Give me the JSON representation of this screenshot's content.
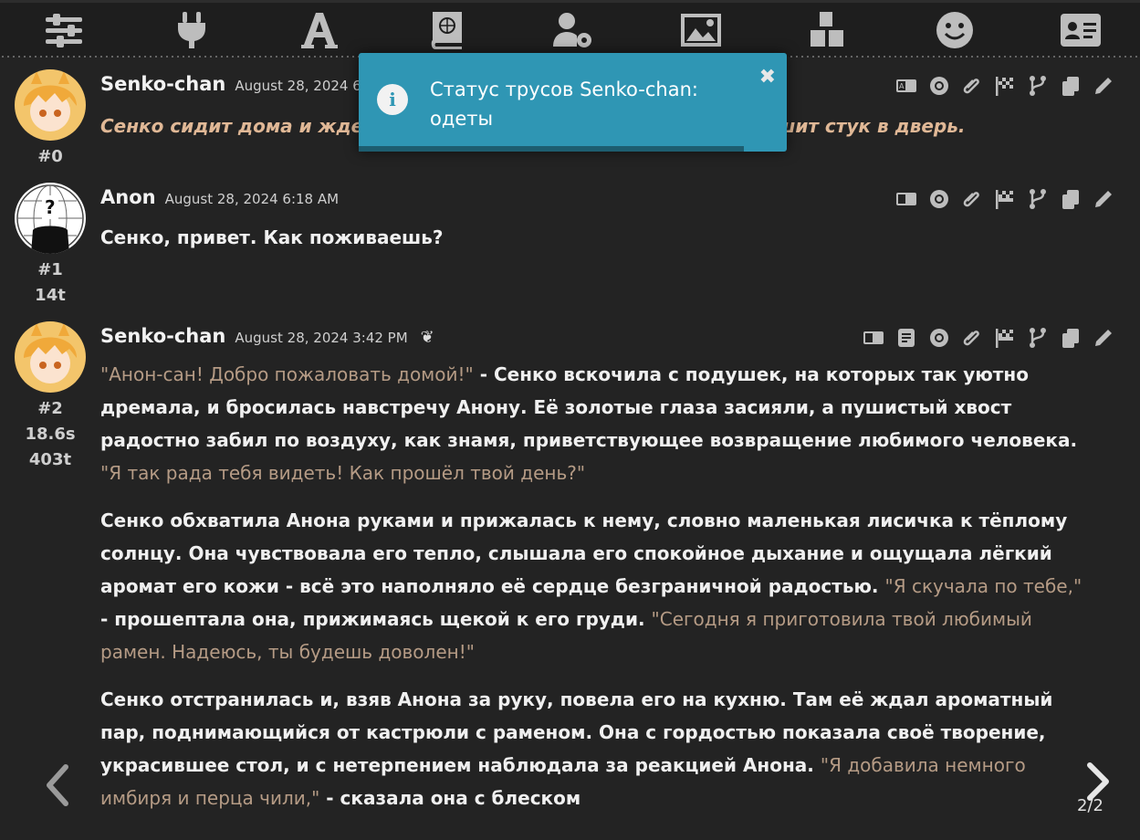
{
  "toolbar": {
    "icons": [
      "sliders-icon",
      "plug-icon",
      "font-icon",
      "book-atlas-icon",
      "user-gear-icon",
      "image-icon",
      "cubes-icon",
      "smiley-icon",
      "id-card-icon"
    ]
  },
  "toast": {
    "message": "Статус трусов Senko-chan: одеты",
    "close": "✖",
    "info": "i",
    "progress": 0.9
  },
  "messages": [
    {
      "name": "Senko-chan",
      "date": "August 28, 2024 6:18",
      "id": "#0",
      "text_italic": "Сенко сидит дома и ждет, когда Анон вернется. Вдруг она слышит стук в дверь."
    },
    {
      "name": "Anon",
      "date": "August 28, 2024 6:18 AM",
      "id": "#1",
      "tokens": "14t",
      "text": "Сенко, привет. Как поживаешь?"
    },
    {
      "name": "Senko-chan",
      "date": "August 28, 2024 3:42 PM",
      "id": "#2",
      "time": "18.6s",
      "tokens": "403t",
      "p1_q1": "\"Анон-сан! Добро пожаловать домой!\"",
      "p1_t1": " - Сенко вскочила с подушек, на которых так уютно дремала, и бросилась навстречу Анону. Её золотые глаза засияли, а пушистый хвост радостно забил по воздуху, как знамя, приветствующее возвращение любимого человека. ",
      "p1_q2": "\"Я так рада тебя видеть! Как прошёл твой день?\"",
      "p2_t1": "Сенко обхватила Анона руками и прижалась к нему, словно маленькая лисичка к тёплому солнцу. Она чувствовала его тепло, слышала его спокойное дыхание и ощущала лёгкий аромат его кожи - всё это наполняло её сердце безграничной радостью. ",
      "p2_q1": "\"Я скучала по тебе,\"",
      "p2_t2": " - прошептала она, прижимаясь щекой к его груди. ",
      "p2_q2": "\"Сегодня я приготовила твой любимый рамен. Надеюсь, ты будешь доволен!\"",
      "p3_t1": "Сенко отстранилась и, взяв Анона за руку, повела его на кухню. Там её ждал ароматный пар, поднимающийся от кастрюли с раменом. Она с гордостью показала своё творение, украсившее стол, и с нетерпением наблюдала за реакцией Анона. ",
      "p3_q1": "\"Я добавила немного имбиря и перца чили,\"",
      "p3_t2": " - сказала она с блеском"
    }
  ],
  "swipe": {
    "counter": "2/2"
  },
  "colors": {
    "background": "#232323",
    "toast": "#2f96b4",
    "quote": "#b59b85",
    "italic": "#e0b896"
  }
}
